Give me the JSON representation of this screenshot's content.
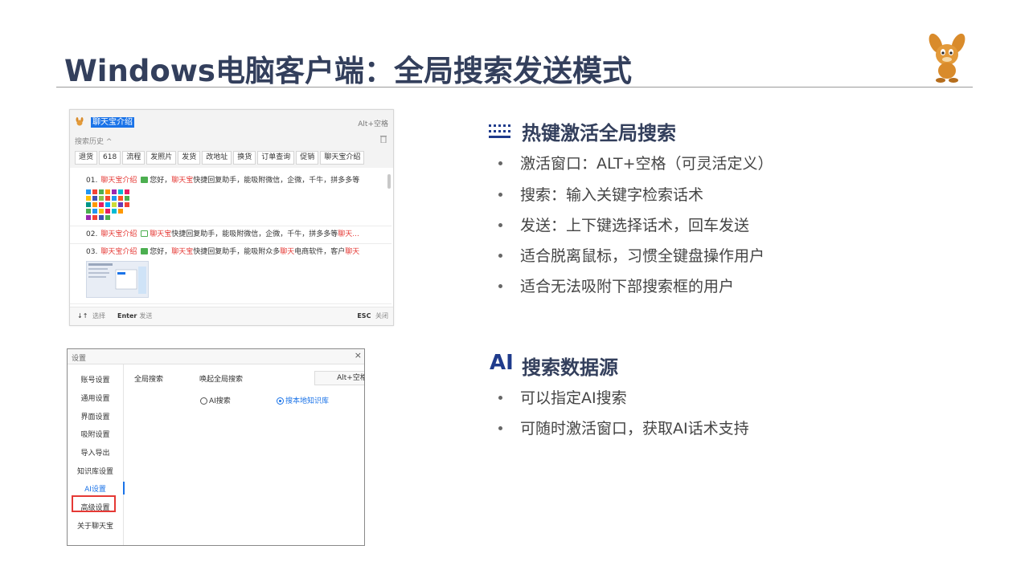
{
  "slide": {
    "title": "Windows电脑客户端：全局搜索发送模式"
  },
  "search_window": {
    "query": "聊天宝介绍",
    "hotkey": "Alt+空格",
    "history_label": "搜索历史 ^",
    "tags": [
      "退货",
      "618",
      "流程",
      "发照片",
      "发货",
      "改地址",
      "换货",
      "订单查询",
      "促销",
      "聊天宝介绍"
    ],
    "results": [
      {
        "num": "01.",
        "title": "聊天宝介绍",
        "pre": "您好，",
        "brand": "聊天宝",
        "text": "快捷回复助手，能吸附微信，企微，千牛，拼多多等"
      },
      {
        "num": "02.",
        "title": "聊天宝介绍",
        "brand": "聊天宝",
        "text": "快捷回复助手，能吸附微信，企微，千牛，拼多多等",
        "tail": "聊天..."
      },
      {
        "num": "03.",
        "title": "聊天宝介绍",
        "pre": "您好，",
        "brand": "聊天宝",
        "text": "快捷回复助手，能吸附众多",
        "mid": "聊天",
        "text2": "电商软件，客户",
        "tail": "聊天"
      }
    ],
    "footer": {
      "select_key": "↓↑",
      "select": "选择",
      "enter_key": "Enter",
      "send": "发送",
      "esc_key": "ESC",
      "close": "关闭"
    }
  },
  "settings_window": {
    "title": "设置",
    "close": "×",
    "sidebar": [
      "账号设置",
      "通用设置",
      "界面设置",
      "吸附设置",
      "导入导出",
      "知识库设置",
      "AI设置",
      "高级设置",
      "关于聊天宝"
    ],
    "active_item": "AI设置",
    "section": "全局搜索",
    "wake_label": "唤起全局搜索",
    "wake_value": "Alt+空格",
    "radio_ai": "AI搜索",
    "radio_local": "搜本地知识库",
    "selected_radio": "搜本地知识库"
  },
  "right": {
    "section1": {
      "heading": "热键激活全局搜索",
      "bullets": [
        "激活窗口：ALT+空格（可灵活定义）",
        "搜索：输入关键字检索话术",
        "发送：上下键选择话术，回车发送",
        "适合脱离鼠标，习惯全键盘操作用户",
        "适合无法吸附下部搜索框的用户"
      ]
    },
    "section2": {
      "icon_text": "AI",
      "heading": "搜索数据源",
      "bullets": [
        "可以指定AI搜索",
        "可随时激活窗口，获取AI话术支持"
      ]
    }
  },
  "colors": {
    "title": "#333f5c",
    "accent_blue": "#1a73e8",
    "highlight_red": "#e53935"
  }
}
